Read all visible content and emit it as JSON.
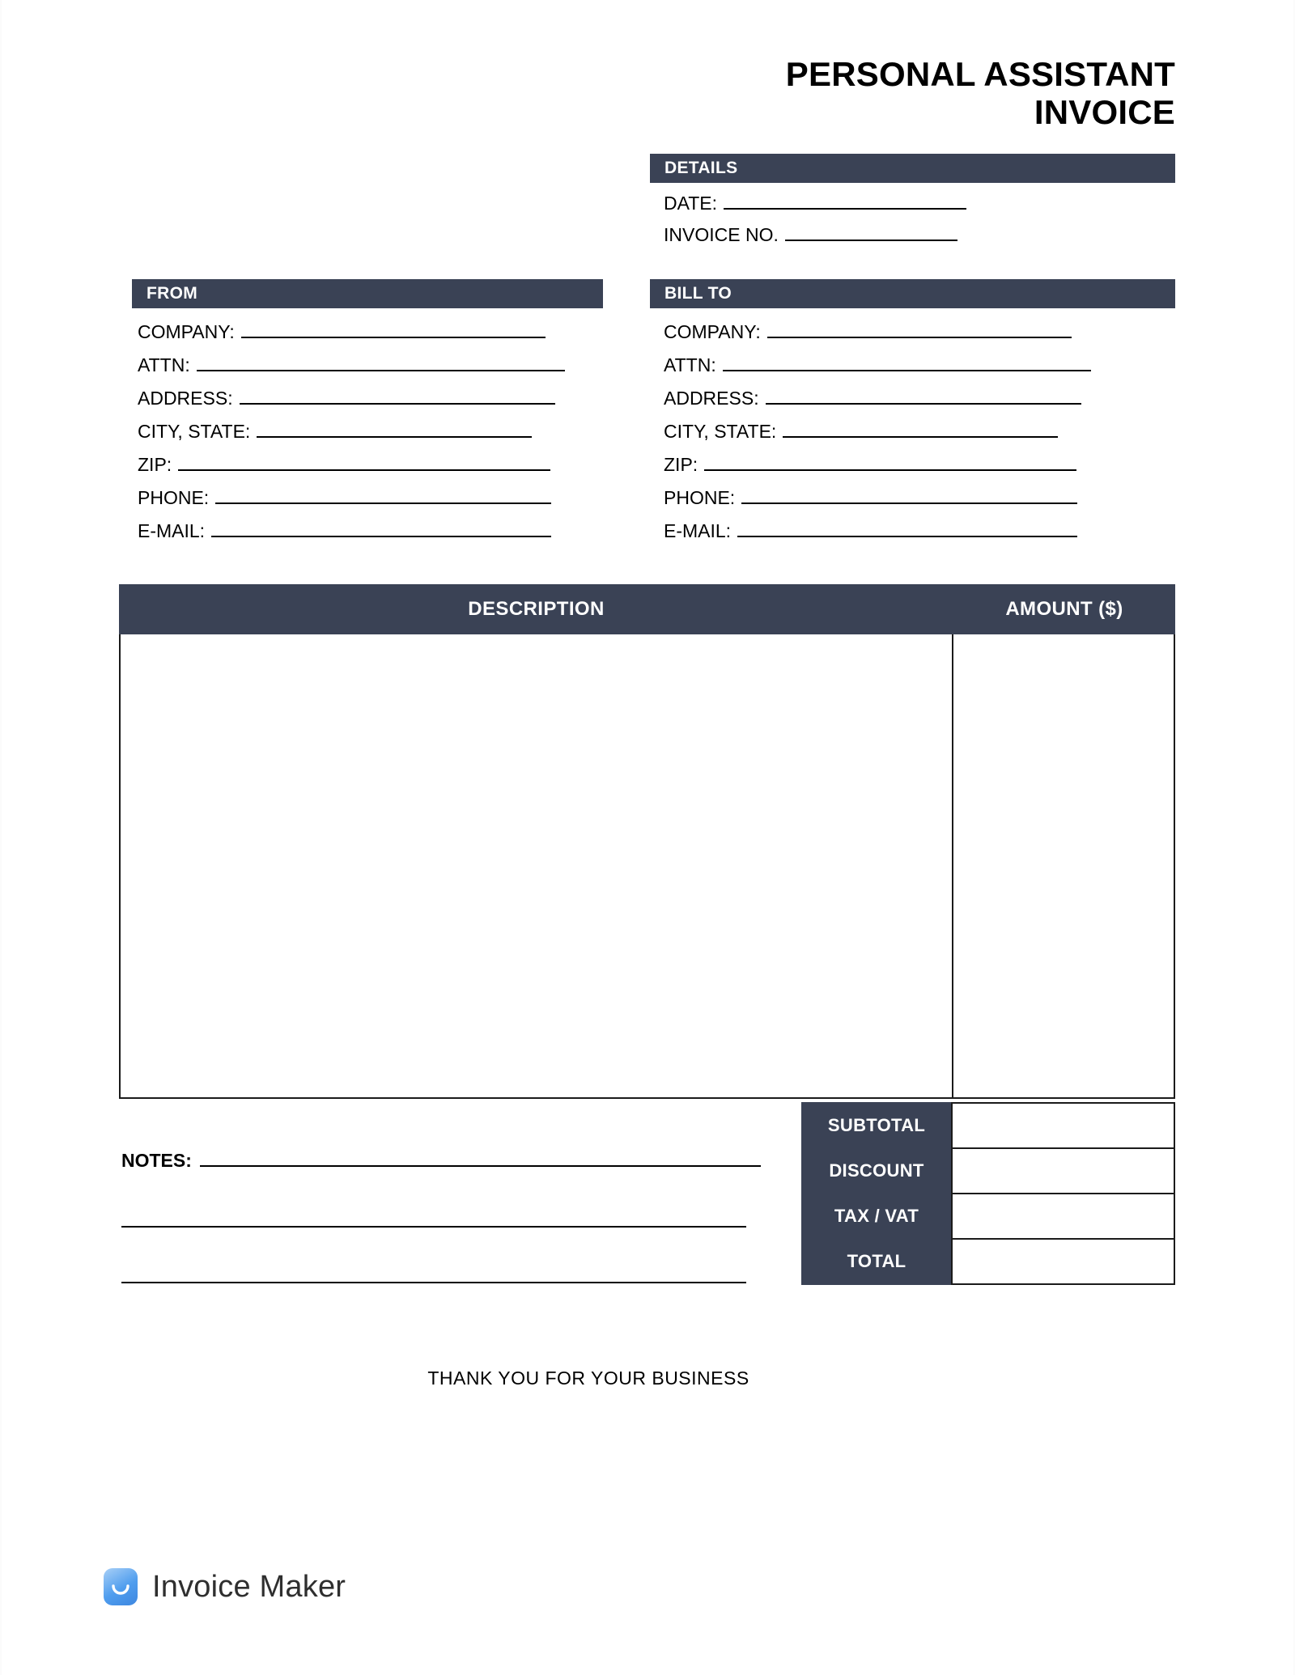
{
  "document": {
    "title_lines": [
      "PERSONAL ASSISTANT",
      "INVOICE"
    ],
    "accent_color": "#3a4255",
    "rule_color": "#000000"
  },
  "details": {
    "header": "DETAILS",
    "fields": [
      {
        "label": "DATE:",
        "value": "",
        "rule_width": 300
      },
      {
        "label": "INVOICE NO.",
        "value": "",
        "rule_width": 213
      }
    ]
  },
  "from": {
    "header": "FROM",
    "fields": [
      {
        "label": "COMPANY:",
        "value": "",
        "rule_width": 376
      },
      {
        "label": "ATTN:",
        "value": "",
        "rule_width": 455
      },
      {
        "label": "ADDRESS:",
        "value": "",
        "rule_width": 390
      },
      {
        "label": "CITY, STATE:",
        "value": "",
        "rule_width": 340
      },
      {
        "label": "ZIP:",
        "value": "",
        "rule_width": 460
      },
      {
        "label": "PHONE:",
        "value": "",
        "rule_width": 415
      },
      {
        "label": "E-MAIL:",
        "value": "",
        "rule_width": 420
      }
    ]
  },
  "bill_to": {
    "header": "BILL TO",
    "fields": [
      {
        "label": "COMPANY:",
        "value": "",
        "rule_width": 376
      },
      {
        "label": "ATTN:",
        "value": "",
        "rule_width": 455
      },
      {
        "label": "ADDRESS:",
        "value": "",
        "rule_width": 390
      },
      {
        "label": "CITY, STATE:",
        "value": "",
        "rule_width": 340
      },
      {
        "label": "ZIP:",
        "value": "",
        "rule_width": 460
      },
      {
        "label": "PHONE:",
        "value": "",
        "rule_width": 415
      },
      {
        "label": "E-MAIL:",
        "value": "",
        "rule_width": 420
      }
    ]
  },
  "items": {
    "columns": [
      "DESCRIPTION",
      "AMOUNT ($)"
    ],
    "rows": []
  },
  "totals": [
    {
      "label": "SUBTOTAL",
      "value": ""
    },
    {
      "label": "DISCOUNT",
      "value": ""
    },
    {
      "label": "TAX / VAT",
      "value": ""
    },
    {
      "label": "TOTAL",
      "value": ""
    }
  ],
  "notes": {
    "label": "NOTES:",
    "value": "",
    "extra_lines": 2
  },
  "footer": {
    "thank_you": "THANK YOU FOR YOUR BUSINESS",
    "brand": "Invoice Maker",
    "logo_icon": "invoice-maker-smile-icon"
  }
}
